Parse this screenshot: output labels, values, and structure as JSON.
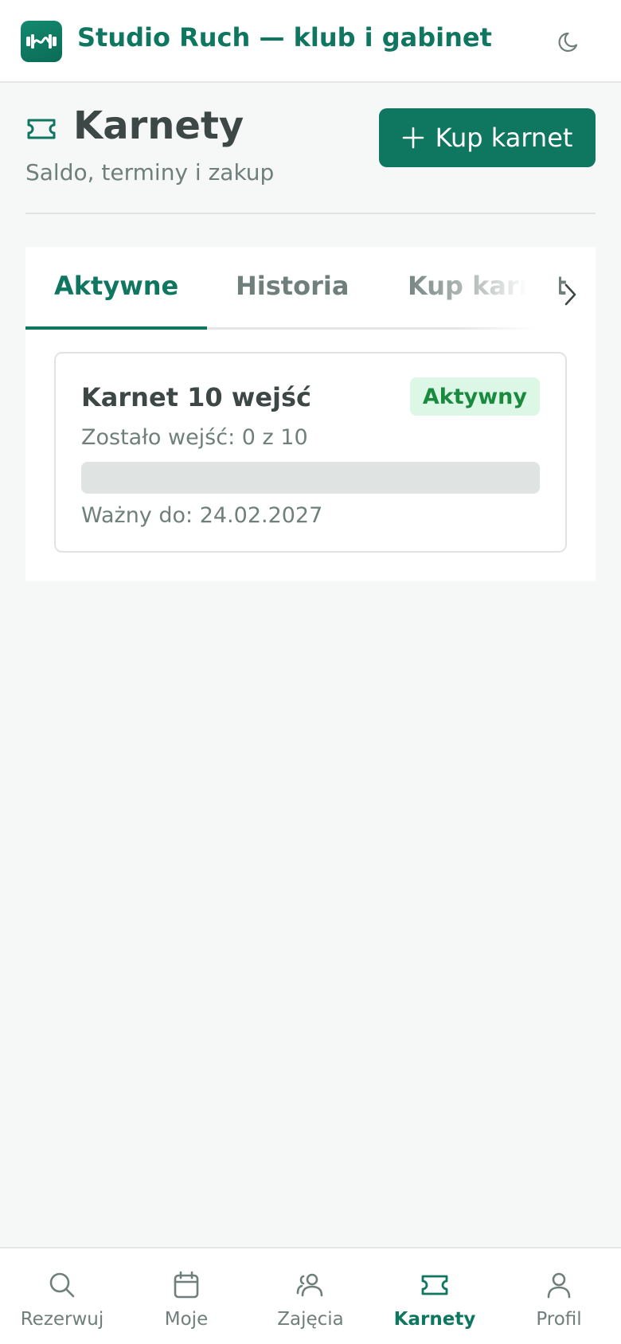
{
  "header": {
    "app_title": "Studio Ruch — klub i gabinet",
    "logo_icon": "dumbbell-icon",
    "theme_toggle_icon": "moon-icon"
  },
  "page": {
    "icon": "ticket-icon",
    "title": "Karnety",
    "subtitle": "Saldo, terminy i zakup",
    "buy_button_label": "Kup karnet",
    "buy_button_icon": "plus-icon"
  },
  "tabs": [
    {
      "label": "Aktywne",
      "active": true
    },
    {
      "label": "Historia",
      "active": false
    },
    {
      "label": "Kup karnet",
      "active": false
    }
  ],
  "pass": {
    "name": "Karnet 10 wejść",
    "status": "Aktywny",
    "remaining_text": "Zostało wejść: 0 z 10",
    "remaining_fraction": 0,
    "valid_until_text": "Ważny do: 24.02.2027"
  },
  "bottom_nav": [
    {
      "label": "Rezerwuj",
      "icon": "search-icon",
      "active": false
    },
    {
      "label": "Moje",
      "icon": "calendar-icon",
      "active": false
    },
    {
      "label": "Zajęcia",
      "icon": "group-icon",
      "active": false
    },
    {
      "label": "Karnety",
      "icon": "ticket-icon",
      "active": true
    },
    {
      "label": "Profil",
      "icon": "user-icon",
      "active": false
    }
  ],
  "colors": {
    "brand": "#0f7660",
    "background": "#f6f7f7",
    "badge_bg": "#dcf7e6",
    "badge_text": "#1a8a3e",
    "muted_text": "#6f7f7b"
  }
}
